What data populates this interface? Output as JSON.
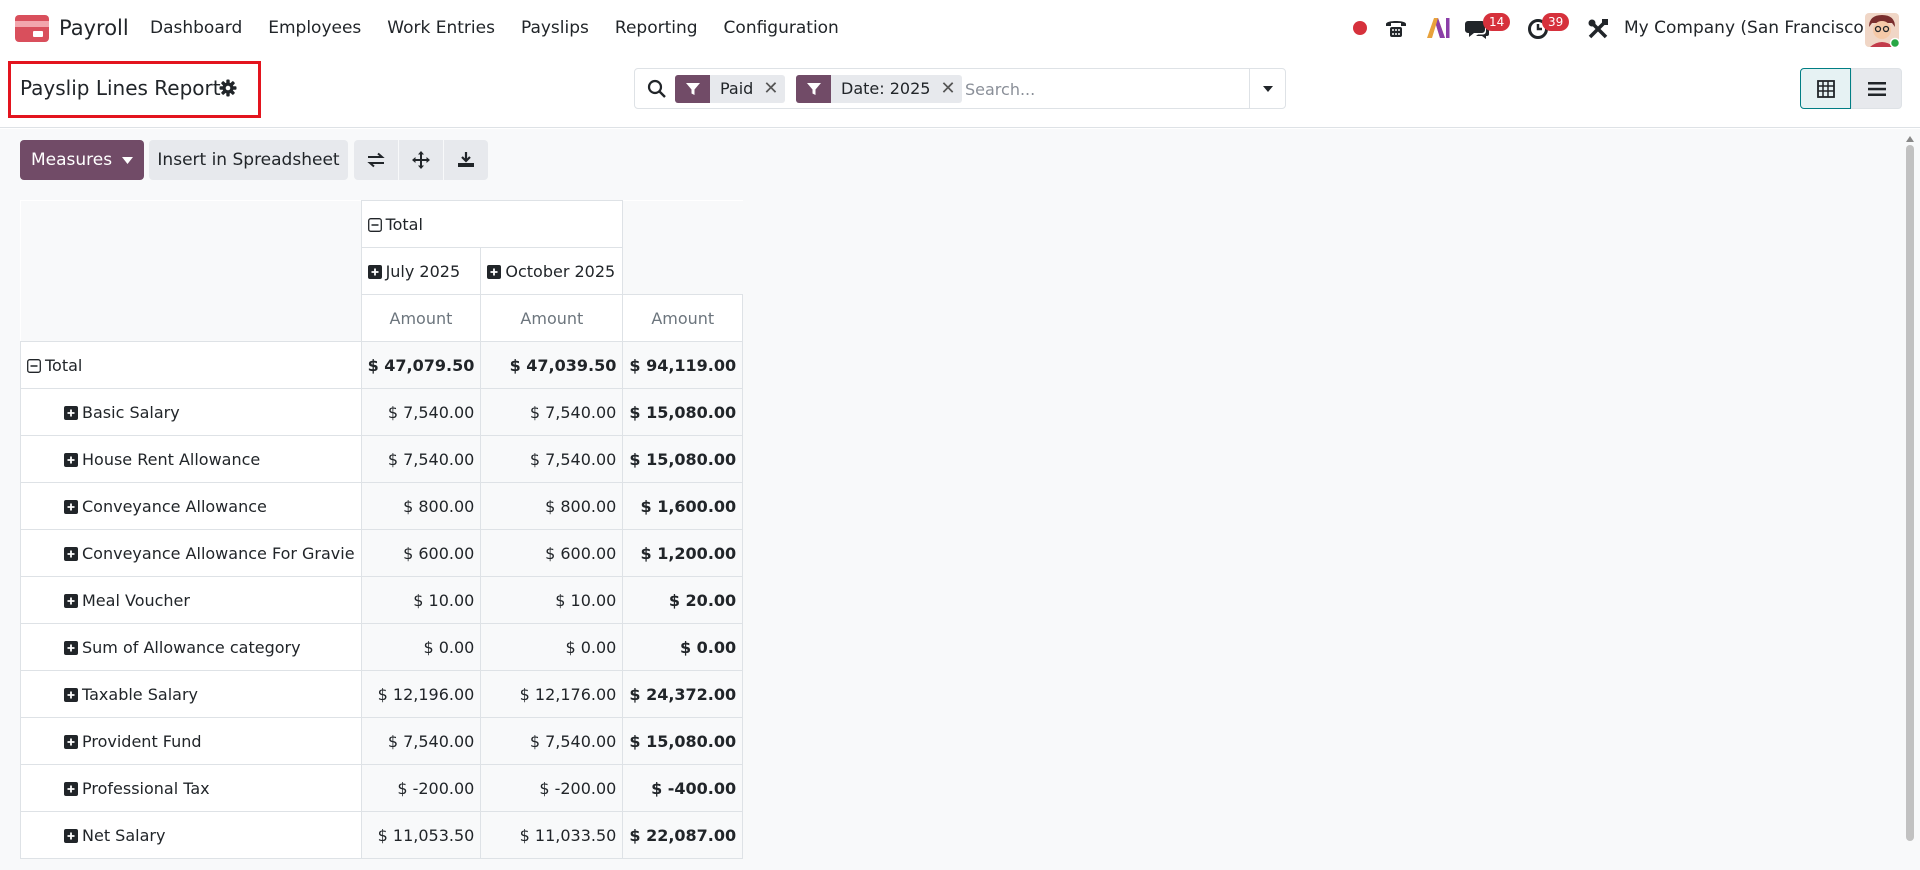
{
  "navbar": {
    "app_name": "Payroll",
    "menu": [
      "Dashboard",
      "Employees",
      "Work Entries",
      "Payslips",
      "Reporting",
      "Configuration"
    ],
    "messages_count": "14",
    "activities_count": "39",
    "company": "My Company (San Francisco)"
  },
  "control": {
    "title": "Payslip Lines Report",
    "facets": [
      "Paid",
      "Date: 2025"
    ],
    "search_placeholder": "Search..."
  },
  "toolbar": {
    "measures_label": "Measures",
    "spreadsheet_label": "Insert in Spreadsheet"
  },
  "pivot": {
    "col_total": "Total",
    "col_groups": [
      "July 2025",
      "October 2025"
    ],
    "measure": "Amount",
    "rows": [
      {
        "label": "Total",
        "values": [
          "$ 47,079.50",
          "$ 47,039.50",
          "$ 94,119.00"
        ]
      },
      {
        "label": "Basic Salary",
        "values": [
          "$ 7,540.00",
          "$ 7,540.00",
          "$ 15,080.00"
        ]
      },
      {
        "label": "House Rent Allowance",
        "values": [
          "$ 7,540.00",
          "$ 7,540.00",
          "$ 15,080.00"
        ]
      },
      {
        "label": "Conveyance Allowance",
        "values": [
          "$ 800.00",
          "$ 800.00",
          "$ 1,600.00"
        ]
      },
      {
        "label": "Conveyance Allowance For Gravie",
        "values": [
          "$ 600.00",
          "$ 600.00",
          "$ 1,200.00"
        ]
      },
      {
        "label": "Meal Voucher",
        "values": [
          "$ 10.00",
          "$ 10.00",
          "$ 20.00"
        ]
      },
      {
        "label": "Sum of Allowance category",
        "values": [
          "$ 0.00",
          "$ 0.00",
          "$ 0.00"
        ]
      },
      {
        "label": "Taxable Salary",
        "values": [
          "$ 12,196.00",
          "$ 12,176.00",
          "$ 24,372.00"
        ]
      },
      {
        "label": "Provident Fund",
        "values": [
          "$ 7,540.00",
          "$ 7,540.00",
          "$ 15,080.00"
        ]
      },
      {
        "label": "Professional Tax",
        "values": [
          "$ -200.00",
          "$ -200.00",
          "$ -400.00"
        ]
      },
      {
        "label": "Net Salary",
        "values": [
          "$ 11,053.50",
          "$ 11,033.50",
          "$ 22,087.00"
        ]
      }
    ]
  },
  "colors": {
    "brand": "#714b67",
    "accent": "#017e84",
    "badge": "#d6313c"
  }
}
